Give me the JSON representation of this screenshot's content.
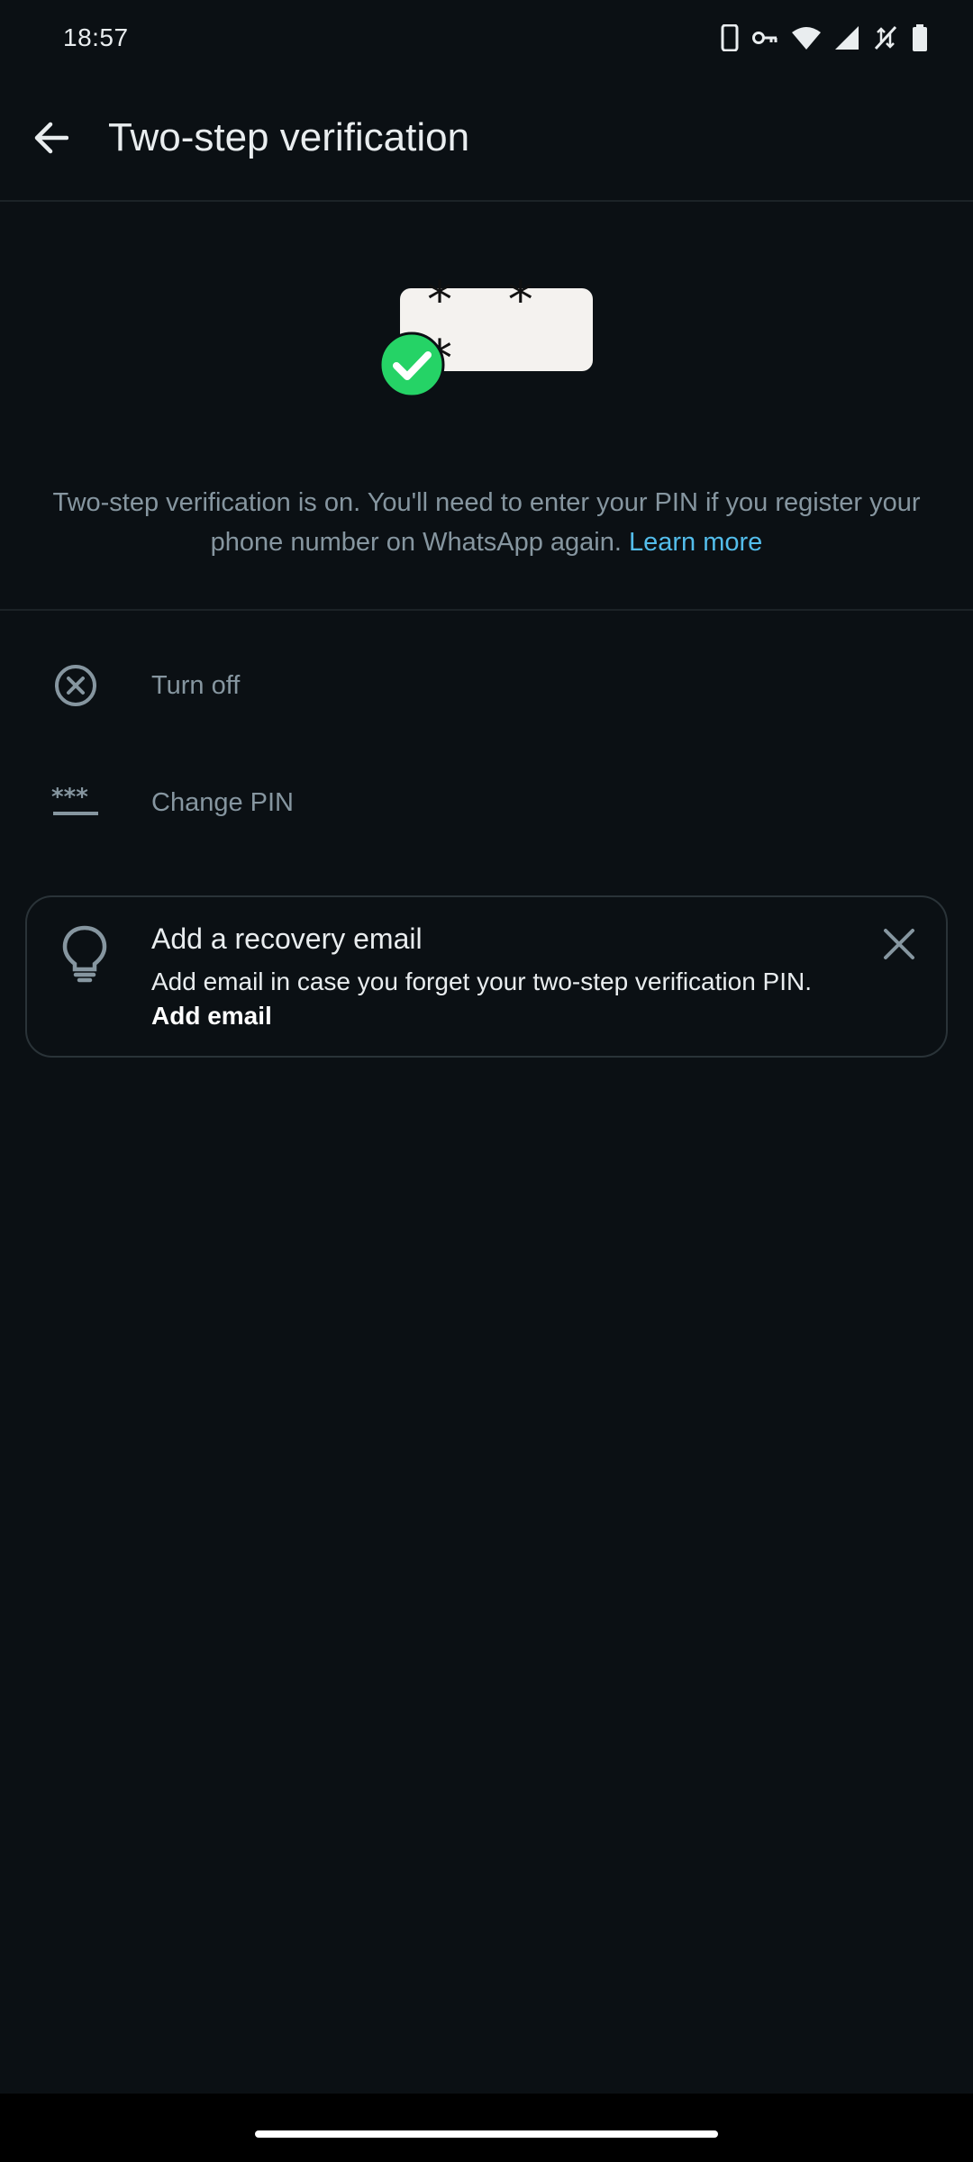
{
  "status_bar": {
    "time": "18:57",
    "icons": [
      "phone-icon",
      "vpn-key-icon",
      "wifi-icon",
      "signal-icon",
      "data-off-icon",
      "battery-icon"
    ]
  },
  "app_bar": {
    "back_icon": "arrow-back-icon",
    "title": "Two-step verification"
  },
  "hero": {
    "pin_mask": "* * *",
    "badge_color": "#25d366"
  },
  "info": {
    "text": "Two-step verification is on. You'll need to enter your PIN if you register your phone number on WhatsApp again.",
    "link": "Learn more",
    "link_color": "#53bdeb"
  },
  "options": [
    {
      "icon": "cancel-circle-icon",
      "label": "Turn off"
    },
    {
      "icon": "password-icon",
      "label": "Change PIN"
    }
  ],
  "recovery_card": {
    "icon": "lightbulb-icon",
    "title": "Add a recovery email",
    "description": "Add email in case you forget your two-step verification PIN.",
    "action": "Add email",
    "close_icon": "close-icon"
  }
}
